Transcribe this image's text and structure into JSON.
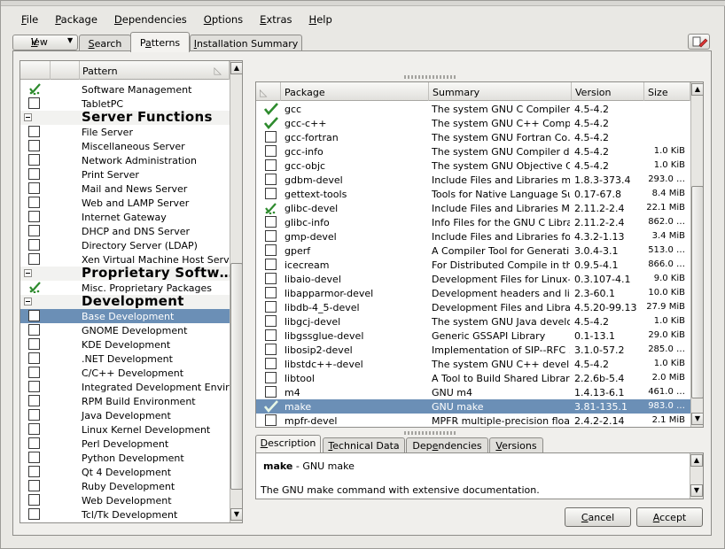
{
  "menu": [
    {
      "mnemonic": "F",
      "rest": "ile"
    },
    {
      "mnemonic": "P",
      "rest": "ackage"
    },
    {
      "mnemonic": "D",
      "rest": "ependencies"
    },
    {
      "mnemonic": "O",
      "rest": "ptions"
    },
    {
      "mnemonic": "E",
      "rest": "xtras"
    },
    {
      "mnemonic": "H",
      "rest": "elp"
    }
  ],
  "view_button": {
    "label": "View",
    "mnemonic": "V",
    "rest": "iew"
  },
  "tabs": {
    "search_m": "S",
    "search_r": "earch",
    "patterns_pre": "P",
    "patterns_m": "a",
    "patterns_r": "tterns",
    "install_m": "I",
    "install_r": "nstallation Summary"
  },
  "pattern_list": {
    "header": "Pattern",
    "rows": [
      {
        "type": "item",
        "label": "Software Management",
        "state": "auto"
      },
      {
        "type": "item",
        "label": "TabletPC",
        "state": "none"
      },
      {
        "type": "cat",
        "label": "Server Functions"
      },
      {
        "type": "item",
        "label": "File Server",
        "state": "none"
      },
      {
        "type": "item",
        "label": "Miscellaneous Server",
        "state": "none"
      },
      {
        "type": "item",
        "label": "Network Administration",
        "state": "none"
      },
      {
        "type": "item",
        "label": "Print Server",
        "state": "none"
      },
      {
        "type": "item",
        "label": "Mail and News Server",
        "state": "none"
      },
      {
        "type": "item",
        "label": "Web and LAMP Server",
        "state": "none"
      },
      {
        "type": "item",
        "label": "Internet Gateway",
        "state": "none"
      },
      {
        "type": "item",
        "label": "DHCP and DNS Server",
        "state": "none"
      },
      {
        "type": "item",
        "label": "Directory Server (LDAP)",
        "state": "none"
      },
      {
        "type": "item",
        "label": "Xen Virtual Machine Host Server",
        "state": "none"
      },
      {
        "type": "cat",
        "label": "Proprietary Softw…"
      },
      {
        "type": "item",
        "label": "Misc. Proprietary Packages",
        "state": "auto"
      },
      {
        "type": "cat",
        "label": "Development"
      },
      {
        "type": "item",
        "label": "Base Development",
        "state": "none",
        "selected": true
      },
      {
        "type": "item",
        "label": "GNOME Development",
        "state": "none"
      },
      {
        "type": "item",
        "label": "KDE Development",
        "state": "none"
      },
      {
        "type": "item",
        "label": ".NET Development",
        "state": "none"
      },
      {
        "type": "item",
        "label": "C/C++ Development",
        "state": "none"
      },
      {
        "type": "item",
        "label": "Integrated Development Envir…",
        "state": "none"
      },
      {
        "type": "item",
        "label": "RPM Build Environment",
        "state": "none"
      },
      {
        "type": "item",
        "label": "Java Development",
        "state": "none"
      },
      {
        "type": "item",
        "label": "Linux Kernel Development",
        "state": "none"
      },
      {
        "type": "item",
        "label": "Perl Development",
        "state": "none"
      },
      {
        "type": "item",
        "label": "Python Development",
        "state": "none"
      },
      {
        "type": "item",
        "label": "Qt 4 Development",
        "state": "none"
      },
      {
        "type": "item",
        "label": "Ruby Development",
        "state": "none"
      },
      {
        "type": "item",
        "label": "Web Development",
        "state": "none"
      },
      {
        "type": "item",
        "label": "Tcl/Tk Development",
        "state": "none"
      }
    ]
  },
  "package_table": {
    "headers": {
      "package": "Package",
      "summary": "Summary",
      "version": "Version",
      "size": "Size"
    },
    "rows": [
      {
        "state": "installed",
        "name": "gcc",
        "summary": "The system GNU C Compiler",
        "version": "4.5-4.2",
        "size": ""
      },
      {
        "state": "installed",
        "name": "gcc-c++",
        "summary": "The system GNU C++ Comp…",
        "version": "4.5-4.2",
        "size": ""
      },
      {
        "state": "none",
        "name": "gcc-fortran",
        "summary": "The system GNU Fortran Co…",
        "version": "4.5-4.2",
        "size": ""
      },
      {
        "state": "none",
        "name": "gcc-info",
        "summary": "The system GNU Compiler d…",
        "version": "4.5-4.2",
        "size": "1.0 KiB"
      },
      {
        "state": "none",
        "name": "gcc-objc",
        "summary": "The system GNU Objective C…",
        "version": "4.5-4.2",
        "size": "1.0 KiB"
      },
      {
        "state": "none",
        "name": "gdbm-devel",
        "summary": "Include Files and Libraries ma…",
        "version": "1.8.3-373.4",
        "size": "293.0 …"
      },
      {
        "state": "none",
        "name": "gettext-tools",
        "summary": "Tools for Native Language Su…",
        "version": "0.17-67.8",
        "size": "8.4 MiB"
      },
      {
        "state": "auto",
        "name": "glibc-devel",
        "summary": "Include Files and Libraries Ma…",
        "version": "2.11.2-2.4",
        "size": "22.1 MiB"
      },
      {
        "state": "none",
        "name": "glibc-info",
        "summary": "Info Files for the GNU C Library",
        "version": "2.11.2-2.4",
        "size": "862.0 …"
      },
      {
        "state": "none",
        "name": "gmp-devel",
        "summary": "Include Files and Libraries for …",
        "version": "4.3.2-1.13",
        "size": "3.4 MiB"
      },
      {
        "state": "none",
        "name": "gperf",
        "summary": "A Compiler Tool for Generatin…",
        "version": "3.0.4-3.1",
        "size": "513.0 …"
      },
      {
        "state": "none",
        "name": "icecream",
        "summary": "For Distributed Compile in th…",
        "version": "0.9.5-4.1",
        "size": "866.0 …"
      },
      {
        "state": "none",
        "name": "libaio-devel",
        "summary": "Development Files for Linux-…",
        "version": "0.3.107-4.1",
        "size": "9.0 KiB"
      },
      {
        "state": "none",
        "name": "libapparmor-devel",
        "summary": "Development headers and lib…",
        "version": "2.3-60.1",
        "size": "10.0 KiB"
      },
      {
        "state": "none",
        "name": "libdb-4_5-devel",
        "summary": "Development Files and Librari…",
        "version": "4.5.20-99.13",
        "size": "27.9 MiB"
      },
      {
        "state": "none",
        "name": "libgcj-devel",
        "summary": "The system GNU Java develo…",
        "version": "4.5-4.2",
        "size": "1.0 KiB"
      },
      {
        "state": "none",
        "name": "libgssglue-devel",
        "summary": "Generic GSSAPI Library",
        "version": "0.1-13.1",
        "size": "29.0 KiB"
      },
      {
        "state": "none",
        "name": "libosip2-devel",
        "summary": "Implementation of SIP--RFC …",
        "version": "3.1.0-57.2",
        "size": "285.0 …"
      },
      {
        "state": "none",
        "name": "libstdc++-devel",
        "summary": "The system GNU C++ devel…",
        "version": "4.5-4.2",
        "size": "1.0 KiB"
      },
      {
        "state": "none",
        "name": "libtool",
        "summary": "A Tool to Build Shared Libraries",
        "version": "2.2.6b-5.4",
        "size": "2.0 MiB"
      },
      {
        "state": "none",
        "name": "m4",
        "summary": "GNU m4",
        "version": "1.4.13-6.1",
        "size": "461.0 …"
      },
      {
        "state": "installed",
        "name": "make",
        "summary": "GNU make",
        "version": "3.81-135.1",
        "size": "983.0 …",
        "selected": true
      },
      {
        "state": "none",
        "name": "mpfr-devel",
        "summary": "MPFR multiple-precision floati…",
        "version": "2.4.2-2.14",
        "size": "2.1 MiB"
      }
    ]
  },
  "detail_tabs": {
    "desc_m": "D",
    "desc_r": "escription",
    "tech_m": "T",
    "tech_r": "echnical Data",
    "deps_pre": "Dep",
    "deps_m": "e",
    "deps_r": "ndencies",
    "vers_m": "V",
    "vers_r": "ersions"
  },
  "description": {
    "name": "make",
    "sep": " - ",
    "short": "GNU make",
    "long": "The GNU make command with extensive documentation."
  },
  "buttons": {
    "cancel_m": "C",
    "cancel_r": "ancel",
    "accept_m": "A",
    "accept_r": "ccept"
  },
  "colors": {
    "selection": "#6b8fb6",
    "check_green": "#2e8b2e"
  }
}
